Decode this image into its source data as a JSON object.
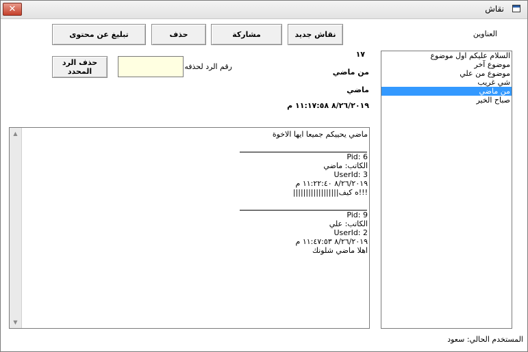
{
  "window": {
    "title": "نقاش",
    "close_glyph": "✕"
  },
  "toolbar": {
    "new_discussion": "نقاش جديد",
    "share": "مشاركة",
    "delete": "حذف",
    "report": "تبليغ عن محتوى",
    "delete_selected_reply": "حذف الرد المحدد"
  },
  "labels": {
    "titles": "العناوين",
    "reply_number": "رقم الرد لحذفه:"
  },
  "post": {
    "id": "١٧",
    "author_line": "من ماضي",
    "author": "ماضي",
    "date": "٨/٢٦/٢٠١٩ ١١:١٧:٥٨ م"
  },
  "topics": [
    {
      "label": "السلام عليكم اول موضوع",
      "selected": false
    },
    {
      "label": "موضوع آخر",
      "selected": false
    },
    {
      "label": "موضوع من علي",
      "selected": false
    },
    {
      "label": "شي غريب",
      "selected": false
    },
    {
      "label": "من ماضي",
      "selected": true
    },
    {
      "label": "صباح الخير",
      "selected": false
    }
  ],
  "content": {
    "body": "ماضي يحييكم جميعا ايها الاخوة",
    "replies": [
      {
        "pid": "Pid: 6",
        "author": "الكاتب: ماضي",
        "userid": "UserId: 3",
        "date": "٨/٢٦/٢٠١٩ ١١:٢٢:٤٠ م",
        "text": "!!!ه كيف||||||||||||||||||"
      },
      {
        "pid": "Pid: 9",
        "author": "الكاتب: علي",
        "userid": "UserId: 2",
        "date": "٨/٢٦/٢٠١٩ ١١:٤٧:٥٣ م",
        "text": "اهلا ماضي شلونك"
      }
    ]
  },
  "status": {
    "current_user": "المستخدم الحالي: سعود"
  }
}
